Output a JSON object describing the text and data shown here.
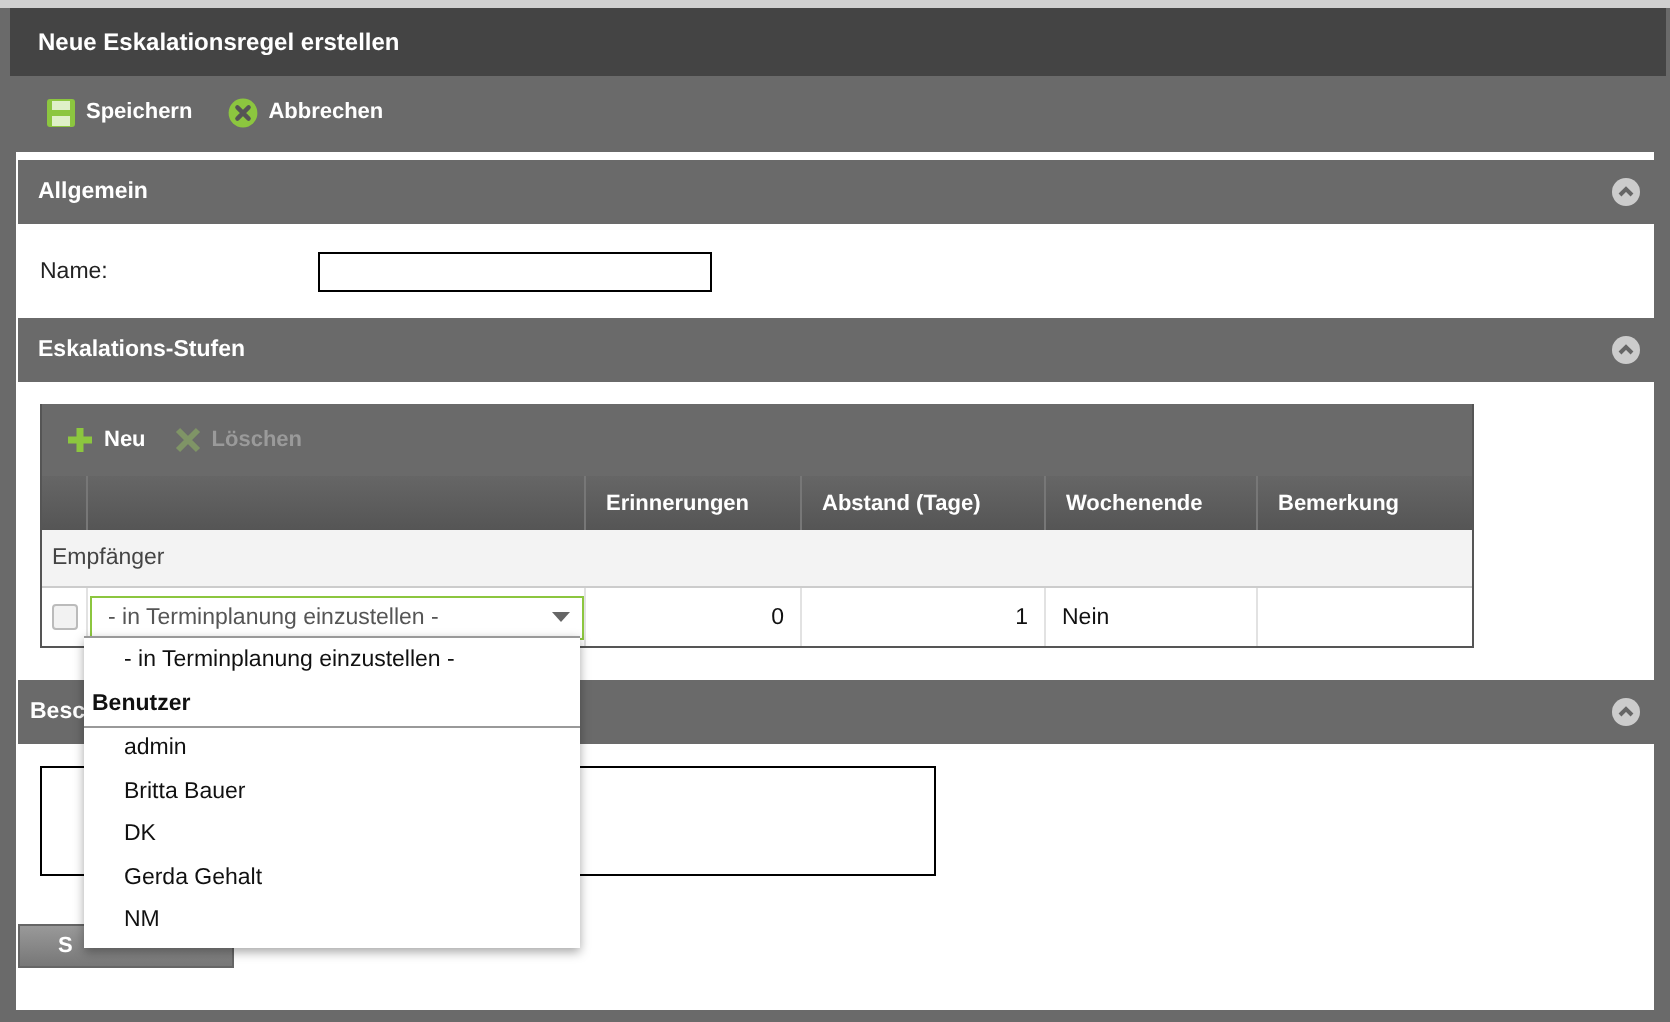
{
  "window": {
    "title": "Neue Eskalationsregel erstellen"
  },
  "toolbar": [
    {
      "label": "Speichern",
      "kind": "save"
    },
    {
      "label": "Abbrechen",
      "kind": "cancel"
    }
  ],
  "general": {
    "title": "Allgemein",
    "expanded": true,
    "name_label": "Name:"
  },
  "levels": {
    "title": "Eskalations-Stufen",
    "expanded": true,
    "actions": [
      {
        "label": "Neu",
        "kind": "add",
        "disabled": false
      },
      {
        "label": "Löschen",
        "kind": "delete",
        "disabled": true
      }
    ],
    "columns": [
      "Erinnerungen",
      "Abstand (Tage)",
      "Wochenende",
      "Bemerkung"
    ],
    "group": "Empfänger",
    "rows": [
      {
        "checked": false,
        "recipient": "- in Terminplanung einzustellen -",
        "reminders": "0",
        "interval": "1",
        "weekend": "Nein"
      }
    ]
  },
  "dropdown": {
    "options": [
      {
        "kind": "option",
        "label": "- in Terminplanung einzustellen -"
      },
      {
        "kind": "group",
        "label": "Benutzer"
      },
      {
        "kind": "option",
        "label": "admin"
      },
      {
        "kind": "option",
        "label": "Britta Bauer"
      },
      {
        "kind": "option",
        "label": "DK"
      },
      {
        "kind": "option",
        "label": "Gerda Gehalt"
      },
      {
        "kind": "option",
        "label": "NM"
      }
    ]
  },
  "description": {
    "title": "Besc",
    "expanded": true
  },
  "footer_button": {
    "label": "S"
  }
}
